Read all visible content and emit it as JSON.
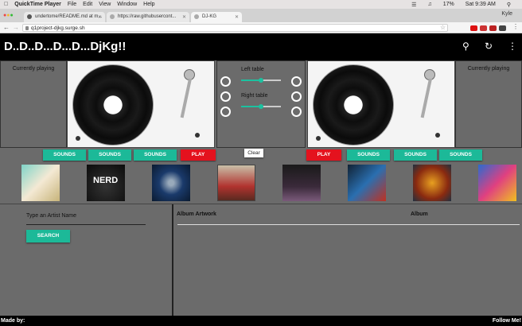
{
  "mac_menubar": {
    "app_name": "QuickTime Player",
    "menus": [
      "File",
      "Edit",
      "View",
      "Window",
      "Help"
    ],
    "battery": "17%",
    "clock": "Sat 9:39 AM"
  },
  "browser": {
    "profile_name": "Kyle",
    "tabs": [
      {
        "label": "undertome/README.md at m..."
      },
      {
        "label": "https://raw.githubusercont..."
      },
      {
        "label": "DJ-KG"
      }
    ],
    "url": "q1project-djkg.surge.sh"
  },
  "app": {
    "title": "D..D..D...D...D...DjKg!!",
    "search_icon": "search-icon",
    "refresh_icon": "refresh-icon",
    "menu_icon": "more-vert-icon"
  },
  "decks": {
    "left_now_playing": "Currently playing",
    "right_now_playing": "Currently playing",
    "left_table_label": "Left table",
    "right_table_label": "Right table",
    "left_table_level": 0.5,
    "right_table_level": 0.5
  },
  "controls": {
    "left_buttons": [
      "SOUNDS",
      "SOUNDS",
      "SOUNDS"
    ],
    "left_play": "PLAY",
    "clear": "Clear",
    "right_play": "PLAY",
    "right_buttons": [
      "SOUNDS",
      "SOUNDS",
      "SOUNDS"
    ]
  },
  "search": {
    "label": "Type an Artist Name",
    "button": "SEARCH",
    "columns": [
      "Album Artwork",
      "Album"
    ]
  },
  "footer": {
    "made_by": "Made by:",
    "follow": "Follow Me!"
  },
  "colors": {
    "accent": "#1cb998",
    "play": "#e4121e",
    "panel": "#6b6b6b",
    "header": "#000000"
  }
}
